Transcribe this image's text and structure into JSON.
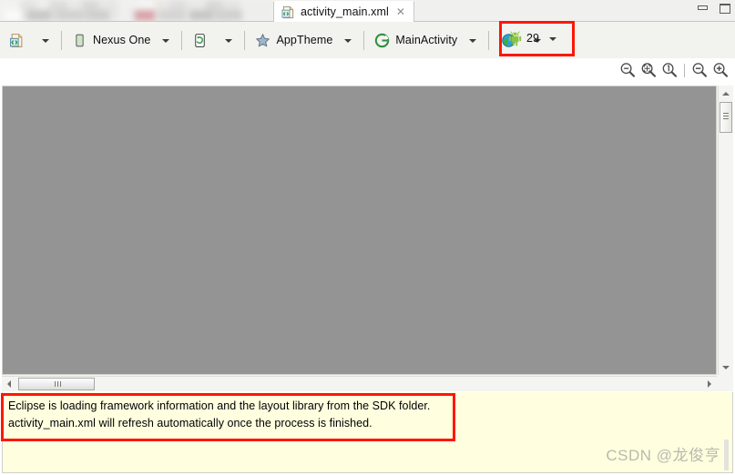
{
  "window": {
    "minimize_icon": "window-minimize-icon",
    "maximize_icon": "window-maximize-icon"
  },
  "tabs": {
    "blurred_count": 2,
    "active": {
      "label": "activity_main.xml",
      "icon": "xml-file-icon",
      "close_glyph": "✕"
    }
  },
  "toolbar": {
    "items": [
      {
        "id": "layout-file",
        "label": "",
        "icon": "xml-layout-icon",
        "has_caret": true
      },
      {
        "id": "device",
        "label": "Nexus One",
        "icon": "device-phone-icon",
        "has_caret": true
      },
      {
        "id": "orientation",
        "label": "",
        "icon": "orientation-portrait-icon",
        "has_caret": true
      },
      {
        "id": "theme",
        "label": "AppTheme",
        "icon": "theme-star-icon",
        "has_caret": true
      },
      {
        "id": "activity",
        "label": "MainActivity",
        "icon": "activity-circle-icon",
        "has_caret": true
      },
      {
        "id": "locale",
        "label": "",
        "icon": "globe-locale-icon",
        "has_caret": true
      }
    ],
    "api_level": {
      "label": "29",
      "icon": "android-robot-icon",
      "has_caret": true,
      "highlight_color": "#fd1705"
    }
  },
  "zoom_controls": [
    {
      "id": "zoom-out-fit",
      "icon": "zoom-fit-out-icon",
      "title": "Zoom out"
    },
    {
      "id": "zoom-fit",
      "icon": "zoom-fit-icon",
      "title": "Fit to window"
    },
    {
      "id": "zoom-100",
      "icon": "zoom-100-icon",
      "title": "100%"
    },
    {
      "id": "zoom-minus",
      "icon": "zoom-minus-icon",
      "title": "Zoom out"
    },
    {
      "id": "zoom-plus",
      "icon": "zoom-plus-icon",
      "title": "Zoom in"
    }
  ],
  "canvas": {
    "background_color": "#949494",
    "content": ""
  },
  "scrollbars": {
    "vertical": {
      "thumb_top_pct": 6,
      "thumb_size_pct": 12
    },
    "horizontal": {
      "thumb_left_pct": 2,
      "thumb_size_pct": 11
    }
  },
  "message": {
    "line1": "Eclipse is loading framework information and the layout library from the SDK folder.",
    "line2": "activity_main.xml will refresh automatically once the process is finished.",
    "background_color": "#ffffe0",
    "highlight_color": "#fd1705"
  },
  "watermark": {
    "text": "CSDN @龙俊亨"
  }
}
